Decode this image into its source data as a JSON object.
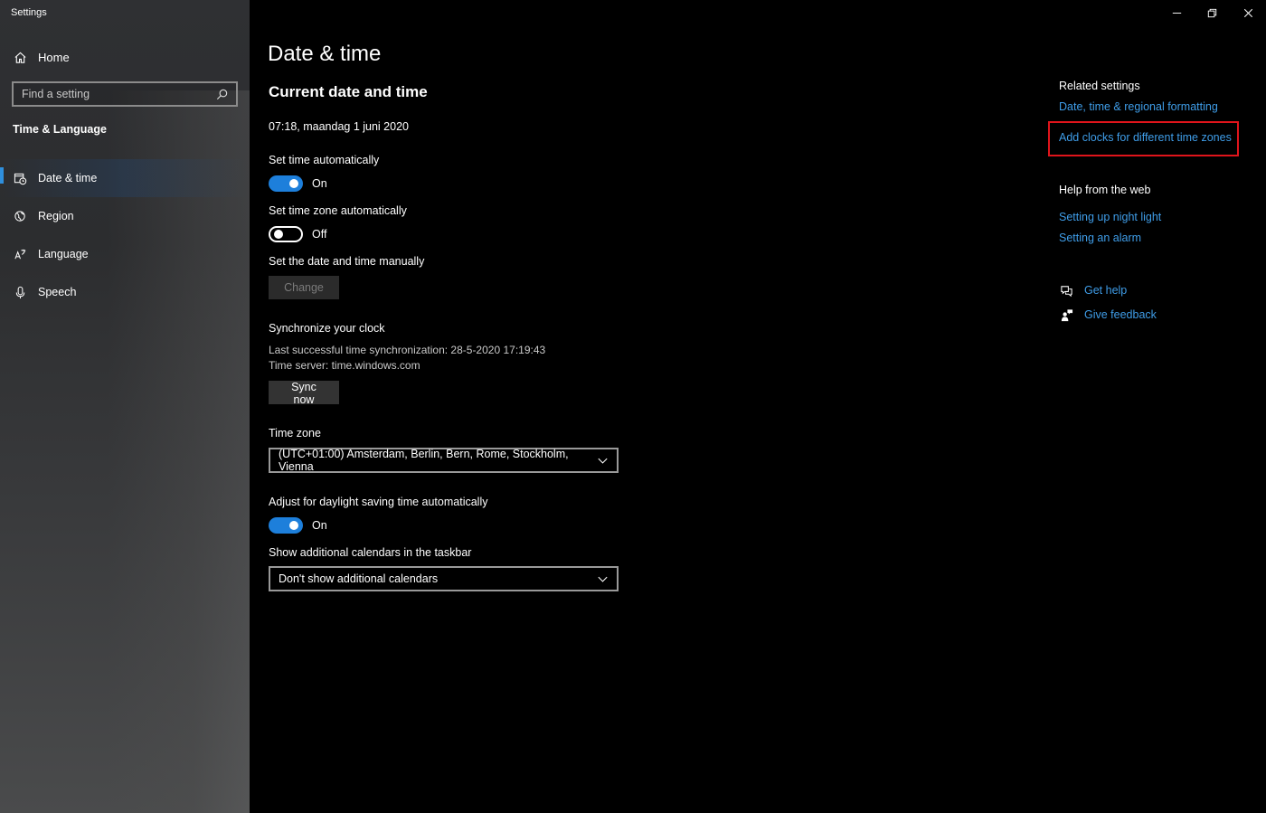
{
  "window": {
    "title": "Settings",
    "controls": [
      "minimize-icon",
      "restore-icon",
      "close-icon"
    ]
  },
  "sidebar": {
    "home_label": "Home",
    "search": {
      "placeholder": "Find a setting",
      "value": ""
    },
    "section_title": "Time & Language",
    "items": [
      {
        "label": "Date & time",
        "icon": "calendar-clock-icon",
        "active": true
      },
      {
        "label": "Region",
        "icon": "globe-icon",
        "active": false
      },
      {
        "label": "Language",
        "icon": "language-icon",
        "active": false
      },
      {
        "label": "Speech",
        "icon": "microphone-icon",
        "active": false
      }
    ]
  },
  "main": {
    "title": "Date & time",
    "subtitle": "Current date and time",
    "current_datetime": "07:18, maandag 1 juni 2020",
    "set_time_auto": {
      "label": "Set time automatically",
      "state": "On"
    },
    "set_timezone_auto": {
      "label": "Set time zone automatically",
      "state": "Off"
    },
    "manual": {
      "label": "Set the date and time manually",
      "button": "Change"
    },
    "sync": {
      "label": "Synchronize your clock",
      "last_sync": "Last successful time synchronization: 28-5-2020 17:19:43",
      "server": "Time server: time.windows.com",
      "button": "Sync now"
    },
    "timezone": {
      "label": "Time zone",
      "selected": "(UTC+01:00) Amsterdam, Berlin, Bern, Rome, Stockholm, Vienna"
    },
    "dst": {
      "label": "Adjust for daylight saving time automatically",
      "state": "On"
    },
    "calendars": {
      "label": "Show additional calendars in the taskbar",
      "selected": "Don't show additional calendars"
    }
  },
  "related": {
    "heading": "Related settings",
    "links": [
      "Date, time & regional formatting",
      "Add clocks for different time zones"
    ],
    "help_heading": "Help from the web",
    "help_links": [
      "Setting up night light",
      "Setting an alarm"
    ],
    "get_help": "Get help",
    "give_feedback": "Give feedback",
    "highlight_color": "#e0141b",
    "link_color": "#3f9de8",
    "accent": "#1d7fdb"
  }
}
